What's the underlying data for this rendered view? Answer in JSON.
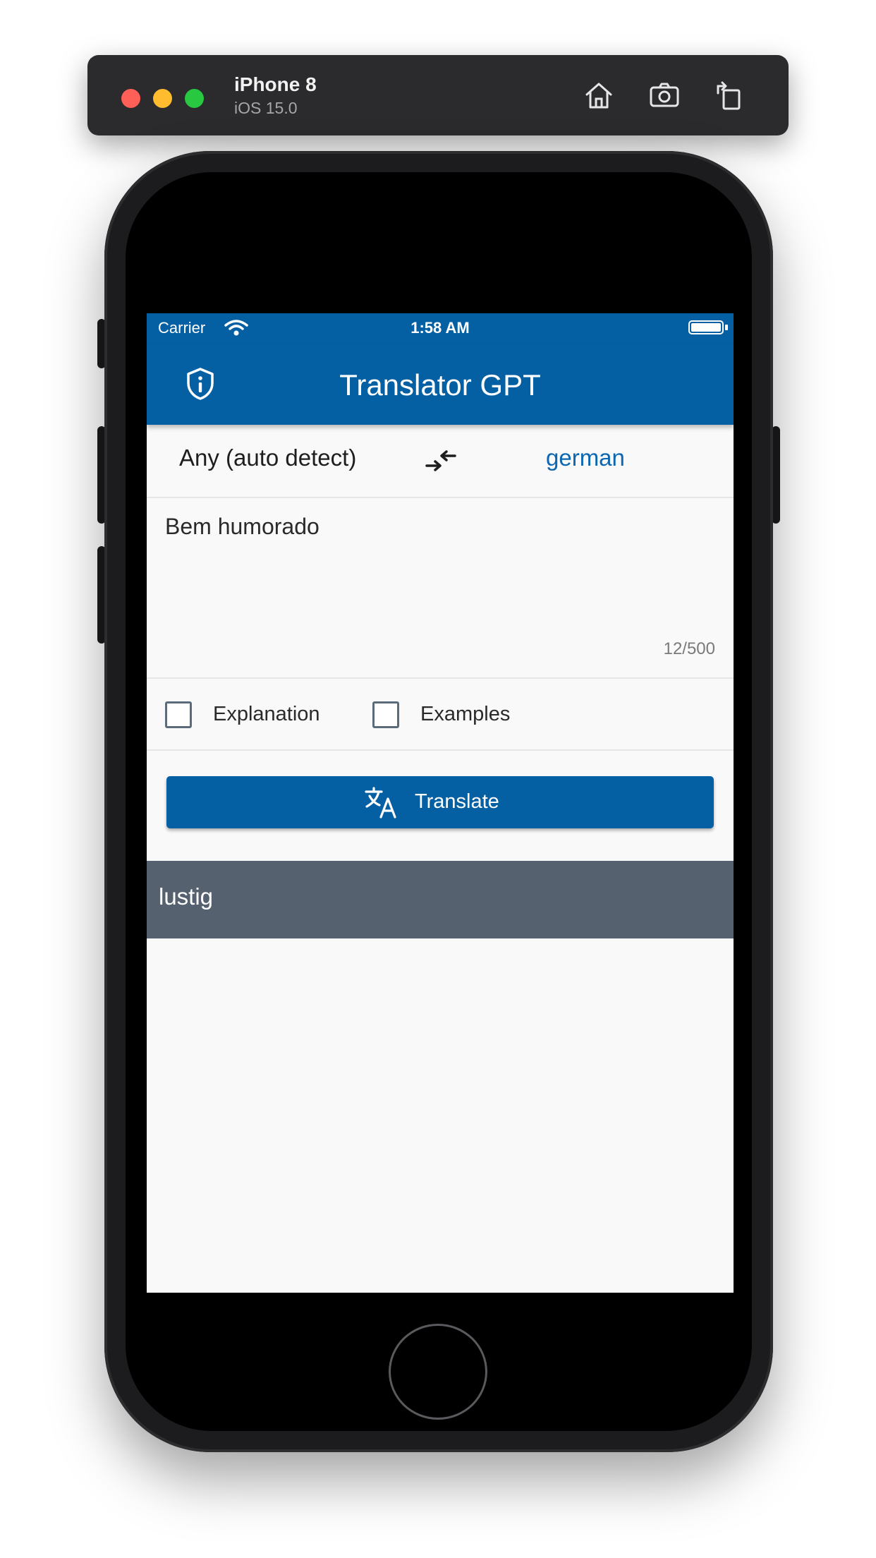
{
  "simulator": {
    "device_name": "iPhone 8",
    "os_version": "iOS 15.0",
    "toolbar_icons": [
      "home-icon",
      "screenshot-icon",
      "rotate-icon"
    ]
  },
  "status_bar": {
    "carrier": "Carrier",
    "time": "1:58 AM"
  },
  "app_bar": {
    "title": "Translator GPT",
    "leading_icon": "shield-info-icon"
  },
  "languages": {
    "source": "Any (auto detect)",
    "target": "german",
    "swap_icon": "swap-arrows-icon"
  },
  "input": {
    "value": "Bem humorado",
    "counter": "12/500"
  },
  "options": [
    {
      "label": "Explanation",
      "checked": false
    },
    {
      "label": "Examples",
      "checked": false
    }
  ],
  "translate_button": {
    "label": "Translate",
    "icon": "translate-icon"
  },
  "result": {
    "text": "lustig"
  },
  "colors": {
    "primary": "#0560a3",
    "target_lang": "#0d67b0",
    "result_background": "#566170",
    "screen_background": "#f9f9f9"
  }
}
